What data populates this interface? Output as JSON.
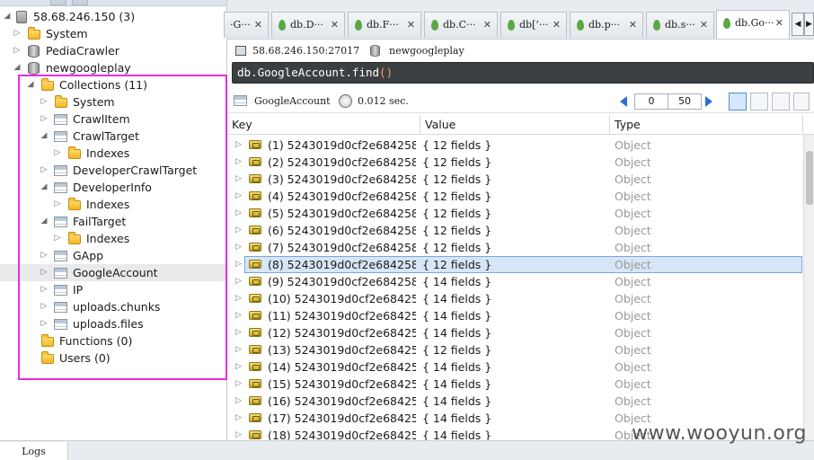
{
  "tree": {
    "server": "58.68.246.150 (3)",
    "databases": [
      "System",
      "PediaCrawler",
      "newgoogleplay"
    ],
    "collections_label": "Collections (11)",
    "collections": [
      "System",
      "CrawlItem",
      "CrawlTarget",
      "Indexes",
      "DeveloperCrawlTarget",
      "DeveloperInfo",
      "Indexes",
      "FailTarget",
      "Indexes",
      "GApp",
      "GoogleAccount",
      "IP",
      "uploads.chunks",
      "uploads.files"
    ],
    "functions_label": "Functions (0)",
    "users_label": "Users (0)"
  },
  "tabs": [
    "·G···",
    "db.D···",
    "db.F···",
    "db.C···",
    "db[’···",
    "db.p···",
    "db.s···",
    "db.Go···"
  ],
  "tab_close": "✕",
  "connection": {
    "host": "58.68.246.150:27017",
    "database": "newgoogleplay"
  },
  "query": {
    "text": "db.GoogleAccount.find",
    "parens": "()"
  },
  "result": {
    "collection": "GoogleAccount",
    "time": "0.012 sec.",
    "skip": "0",
    "limit": "50"
  },
  "columns": [
    "Key",
    "Value",
    "Type"
  ],
  "rows": [
    {
      "key": "(1) 5243019d0cf2e684258f...",
      "value": "{ 12 fields }",
      "type": "Object"
    },
    {
      "key": "(2) 5243019d0cf2e684258f...",
      "value": "{ 12 fields }",
      "type": "Object"
    },
    {
      "key": "(3) 5243019d0cf2e684258f...",
      "value": "{ 12 fields }",
      "type": "Object"
    },
    {
      "key": "(4) 5243019d0cf2e684258f...",
      "value": "{ 12 fields }",
      "type": "Object"
    },
    {
      "key": "(5) 5243019d0cf2e684258f...",
      "value": "{ 12 fields }",
      "type": "Object"
    },
    {
      "key": "(6) 5243019d0cf2e684258f...",
      "value": "{ 12 fields }",
      "type": "Object"
    },
    {
      "key": "(7) 5243019d0cf2e684258f...",
      "value": "{ 12 fields }",
      "type": "Object"
    },
    {
      "key": "(8) 5243019d0cf2e684258f...",
      "value": "{ 12 fields }",
      "type": "Object"
    },
    {
      "key": "(9) 5243019d0cf2e684258f...",
      "value": "{ 14 fields }",
      "type": "Object"
    },
    {
      "key": "(10) 5243019d0cf2e68425...",
      "value": "{ 14 fields }",
      "type": "Object"
    },
    {
      "key": "(11) 5243019d0cf2e68425...",
      "value": "{ 14 fields }",
      "type": "Object"
    },
    {
      "key": "(12) 5243019d0cf2e68425...",
      "value": "{ 14 fields }",
      "type": "Object"
    },
    {
      "key": "(13) 5243019d0cf2e68425...",
      "value": "{ 12 fields }",
      "type": "Object"
    },
    {
      "key": "(14) 5243019d0cf2e68425...",
      "value": "{ 14 fields }",
      "type": "Object"
    },
    {
      "key": "(15) 5243019d0cf2e68425...",
      "value": "{ 14 fields }",
      "type": "Object"
    },
    {
      "key": "(16) 5243019d0cf2e68425...",
      "value": "{ 14 fields }",
      "type": "Object"
    },
    {
      "key": "(17) 5243019d0cf2e68425...",
      "value": "{ 14 fields }",
      "type": "Object"
    },
    {
      "key": "(18) 5243019d0cf2e68425...",
      "value": "{ 14 fields }",
      "type": "Object"
    }
  ],
  "logs_tab": "Logs",
  "watermark": "www.wooyun.org",
  "colors": {
    "highlight_box": "#ea2ce0",
    "query_bg": "#3c3f41",
    "selection": "#d7e6f6"
  }
}
